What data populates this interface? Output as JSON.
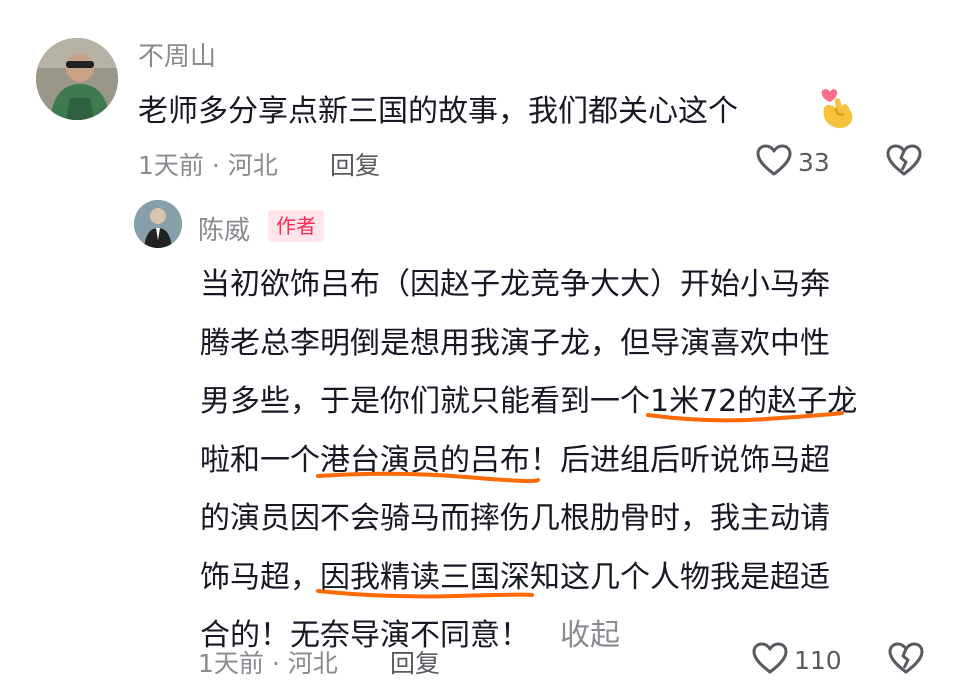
{
  "comments": [
    {
      "username": "不周山",
      "text": "老师多分享点新三国的故事，我们都关心这个",
      "emoji": "finger-heart-emoji",
      "time_location": "1天前 · 河北",
      "reply_label": "回复",
      "like_count": "33"
    },
    {
      "username": "陈威",
      "author_badge": "作者",
      "lines": [
        "当初欲饰吕布（因赵子龙竞争大大）开始小马奔",
        "腾老总李明倒是想用我演子龙，但导演喜欢中性",
        [
          "男多些，于是你们就只能看到一个",
          "1米72的赵子龙"
        ],
        [
          "啦和一个",
          "港台演员的吕布",
          "！后进组后听说饰马超"
        ],
        "的演员因不会骑马而摔伤几根肋骨时，我主动请",
        [
          "饰马超，",
          "因我精读三国深知",
          "这几个人物我是超适"
        ],
        "合的！无奈导演不同意！"
      ],
      "collapse_label": "收起",
      "time_location": "1天前 · 河北",
      "reply_label": "回复",
      "like_count": "110"
    }
  ],
  "colors": {
    "text": "#161823",
    "secondary": "#8a8b91",
    "brand": "#fe2c55",
    "highlight_underline": "#ff6a00"
  },
  "icons": [
    "heart-outline-icon",
    "broken-heart-icon"
  ]
}
